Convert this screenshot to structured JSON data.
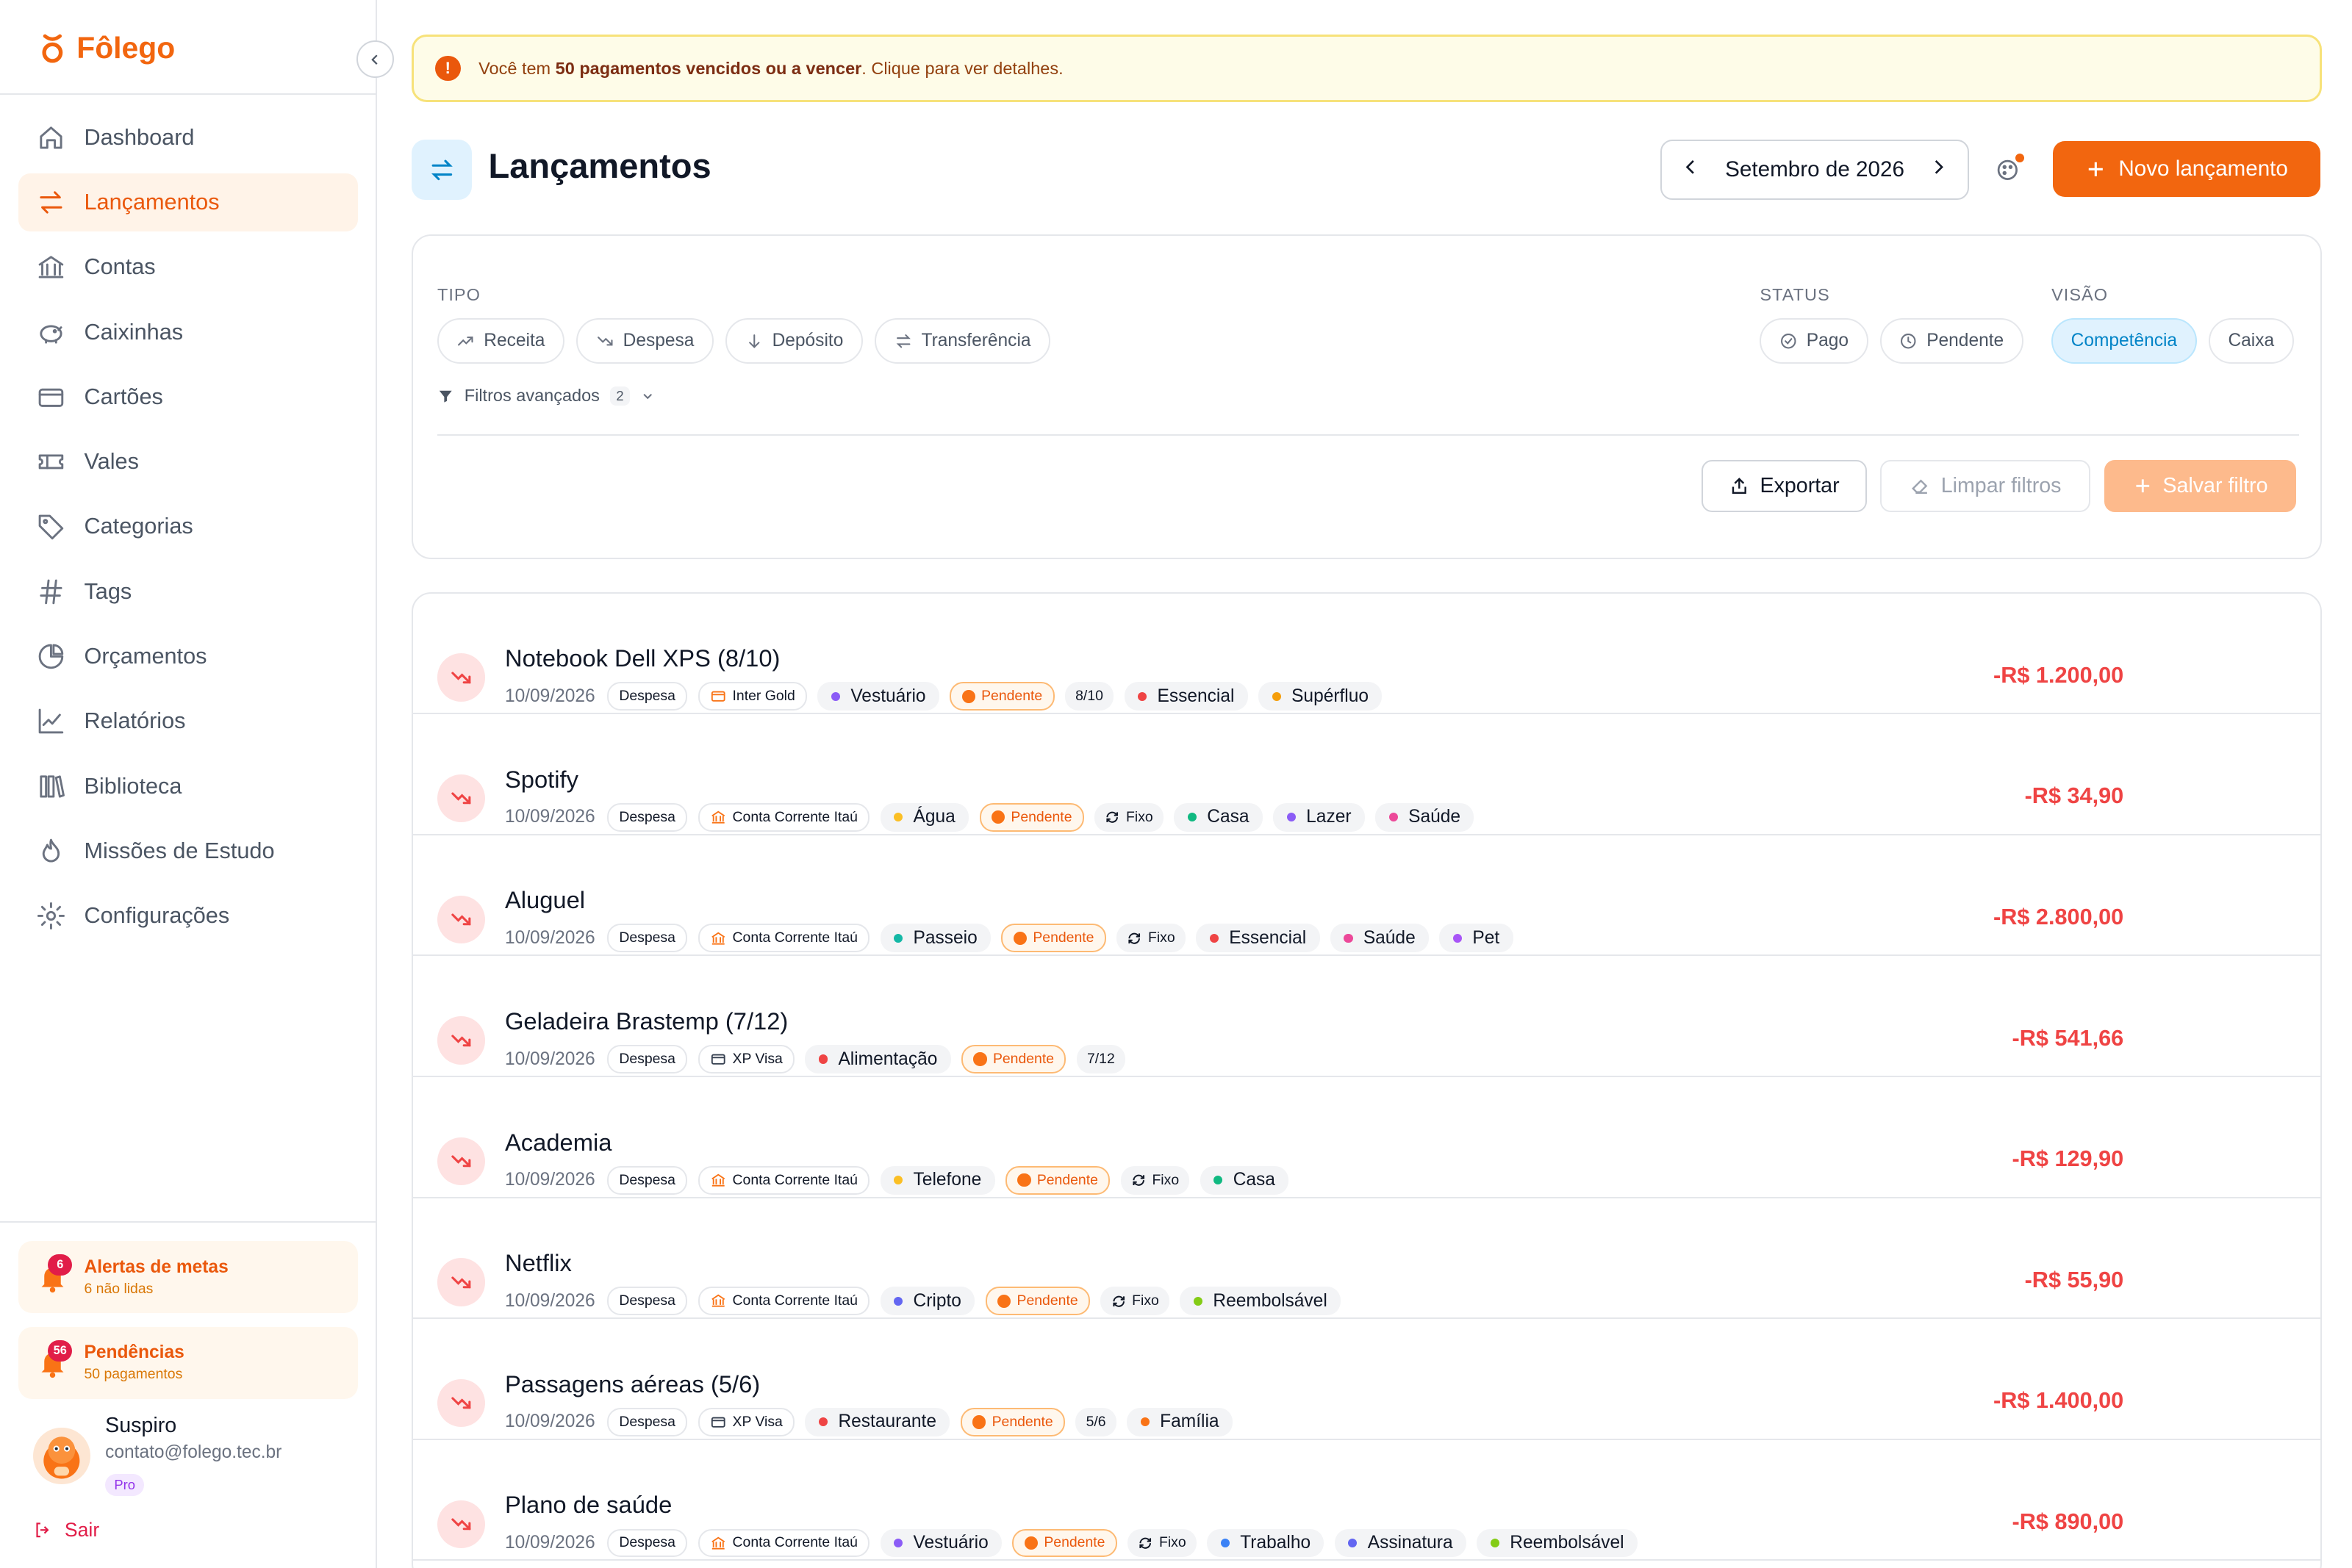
{
  "app": {
    "name": "Fôlego"
  },
  "sidebar": {
    "items": [
      {
        "label": "Dashboard",
        "icon": "home-icon"
      },
      {
        "label": "Lançamentos",
        "icon": "transfer-icon",
        "active": true
      },
      {
        "label": "Contas",
        "icon": "bank-icon"
      },
      {
        "label": "Caixinhas",
        "icon": "piggy-bank-icon"
      },
      {
        "label": "Cartões",
        "icon": "credit-card-icon"
      },
      {
        "label": "Vales",
        "icon": "ticket-icon"
      },
      {
        "label": "Categorias",
        "icon": "tag-icon"
      },
      {
        "label": "Tags",
        "icon": "hash-icon"
      },
      {
        "label": "Orçamentos",
        "icon": "pie-chart-icon"
      },
      {
        "label": "Relatórios",
        "icon": "line-chart-icon"
      },
      {
        "label": "Biblioteca",
        "icon": "library-icon"
      },
      {
        "label": "Missões de Estudo",
        "icon": "flame-icon"
      },
      {
        "label": "Configurações",
        "icon": "gear-icon"
      }
    ],
    "alerts": {
      "title": "Alertas de metas",
      "sub": "6 não lidas",
      "count": "6"
    },
    "pending": {
      "title": "Pendências",
      "sub": "50 pagamentos",
      "count": "56"
    },
    "user": {
      "name": "Suspiro",
      "email": "contato@folego.tec.br",
      "plan": "Pro"
    },
    "logout": "Sair"
  },
  "banner": {
    "pre": "Você tem ",
    "bold": "50 pagamentos vencidos ou a vencer",
    "post": ". Clique para ver detalhes."
  },
  "header": {
    "title": "Lançamentos",
    "month": "Setembro de 2026",
    "new_label": "Novo lançamento"
  },
  "filters": {
    "tipo_label": "TIPO",
    "status_label": "STATUS",
    "visao_label": "VISÃO",
    "tipo": [
      "Receita",
      "Despesa",
      "Depósito",
      "Transferência"
    ],
    "status": [
      "Pago",
      "Pendente"
    ],
    "visao": [
      "Competência",
      "Caixa"
    ],
    "advanced": "Filtros avançados",
    "advanced_count": "2",
    "export": "Exportar",
    "clear": "Limpar filtros",
    "save": "Salvar filtro"
  },
  "colors": {
    "accent": "#f2660f",
    "negative": "#ef4444",
    "selected": "#0284c7"
  },
  "transactions": [
    {
      "name": "Notebook Dell XPS (8/10)",
      "date": "10/09/2026",
      "type": "Despesa",
      "account": "Inter Gold",
      "account_icon": "card",
      "category": "Vestuário",
      "category_color": "#8b5cf6",
      "status": "Pendente",
      "extra": "8/10",
      "tags": [
        {
          "label": "Essencial",
          "color": "#ef4444"
        },
        {
          "label": "Supérfluo",
          "color": "#f59e0b"
        }
      ],
      "amount": "-R$ 1.200,00"
    },
    {
      "name": "Spotify",
      "date": "10/09/2026",
      "type": "Despesa",
      "account": "Conta Corrente Itaú",
      "account_icon": "bank",
      "category": "Água",
      "category_color": "#fbbf24",
      "status": "Pendente",
      "extra": "Fixo",
      "tags": [
        {
          "label": "Casa",
          "color": "#10b981"
        },
        {
          "label": "Lazer",
          "color": "#8b5cf6"
        },
        {
          "label": "Saúde",
          "color": "#ec4899"
        }
      ],
      "amount": "-R$ 34,90"
    },
    {
      "name": "Aluguel",
      "date": "10/09/2026",
      "type": "Despesa",
      "account": "Conta Corrente Itaú",
      "account_icon": "bank",
      "category": "Passeio",
      "category_color": "#14b8a6",
      "status": "Pendente",
      "extra": "Fixo",
      "tags": [
        {
          "label": "Essencial",
          "color": "#ef4444"
        },
        {
          "label": "Saúde",
          "color": "#ec4899"
        },
        {
          "label": "Pet",
          "color": "#a855f7"
        }
      ],
      "amount": "-R$ 2.800,00"
    },
    {
      "name": "Geladeira Brastemp (7/12)",
      "date": "10/09/2026",
      "type": "Despesa",
      "account": "XP Visa",
      "account_icon": "card",
      "category": "Alimentação",
      "category_color": "#ef4444",
      "status": "Pendente",
      "extra": "7/12",
      "tags": [],
      "amount": "-R$ 541,66"
    },
    {
      "name": "Academia",
      "date": "10/09/2026",
      "type": "Despesa",
      "account": "Conta Corrente Itaú",
      "account_icon": "bank",
      "category": "Telefone",
      "category_color": "#fbbf24",
      "status": "Pendente",
      "extra": "Fixo",
      "tags": [
        {
          "label": "Casa",
          "color": "#10b981"
        }
      ],
      "amount": "-R$ 129,90"
    },
    {
      "name": "Netflix",
      "date": "10/09/2026",
      "type": "Despesa",
      "account": "Conta Corrente Itaú",
      "account_icon": "bank",
      "category": "Cripto",
      "category_color": "#6366f1",
      "status": "Pendente",
      "extra": "Fixo",
      "tags": [
        {
          "label": "Reembolsável",
          "color": "#84cc16"
        }
      ],
      "amount": "-R$ 55,90"
    },
    {
      "name": "Passagens aéreas (5/6)",
      "date": "10/09/2026",
      "type": "Despesa",
      "account": "XP Visa",
      "account_icon": "card",
      "category": "Restaurante",
      "category_color": "#ef4444",
      "status": "Pendente",
      "extra": "5/6",
      "tags": [
        {
          "label": "Família",
          "color": "#f97316"
        }
      ],
      "amount": "-R$ 1.400,00"
    },
    {
      "name": "Plano de saúde",
      "date": "10/09/2026",
      "type": "Despesa",
      "account": "Conta Corrente Itaú",
      "account_icon": "bank",
      "category": "Vestuário",
      "category_color": "#8b5cf6",
      "status": "Pendente",
      "extra": "Fixo",
      "tags": [
        {
          "label": "Trabalho",
          "color": "#3b82f6"
        },
        {
          "label": "Assinatura",
          "color": "#6366f1"
        },
        {
          "label": "Reembolsável",
          "color": "#84cc16"
        }
      ],
      "amount": "-R$ 890,00"
    }
  ]
}
